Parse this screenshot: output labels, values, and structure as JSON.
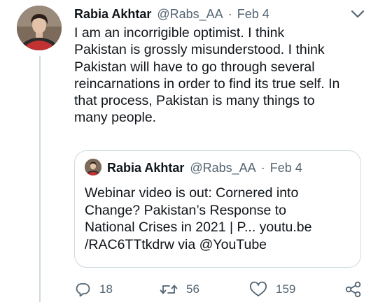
{
  "tweet": {
    "author": {
      "display_name": "Rabia Akhtar",
      "handle": "@Rabs_AA",
      "separator": "·",
      "date": "Feb 4"
    },
    "text": "I am an incorrigible optimist. I think\nPakistan is grossly misunderstood. I think\nPakistan will have to go through several\nreincarnations in order to find its true self. In\nthat process, Pakistan is many things to\nmany people.",
    "more_icon": "more-chevron-icon"
  },
  "quote": {
    "author": {
      "display_name": "Rabia Akhtar",
      "handle": "@Rabs_AA",
      "separator": "·",
      "date": "Feb 4"
    },
    "text": "Webinar video is out: Cornered into\nChange? Pakistan’s Response to\nNational Crises in 2021 | P... youtu.be\n/RAC6TTtkdrw via @YouTube"
  },
  "actions": {
    "reply_count": "18",
    "retweet_count": "56",
    "like_count": "159",
    "icons": [
      "reply-icon",
      "retweet-icon",
      "like-icon",
      "share-icon"
    ]
  },
  "colors": {
    "text_primary": "#0f1419",
    "text_secondary": "#536471",
    "border": "#cfd9de",
    "background": "#ffffff"
  }
}
